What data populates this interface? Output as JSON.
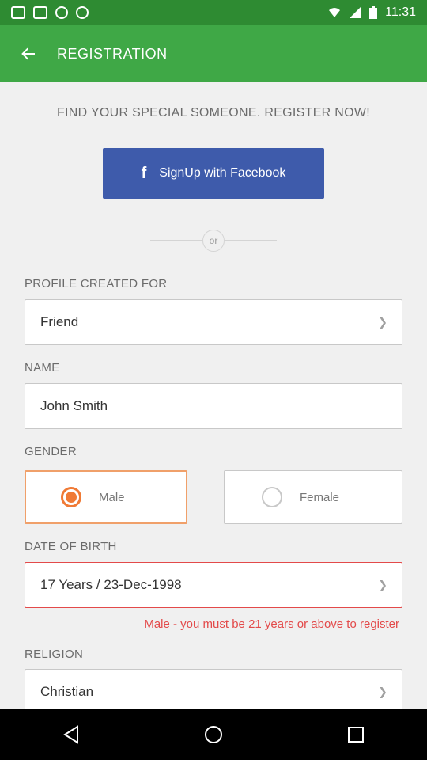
{
  "status_bar": {
    "time": "11:31"
  },
  "app_bar": {
    "title": "REGISTRATION"
  },
  "tagline": "FIND YOUR SPECIAL SOMEONE. REGISTER NOW!",
  "facebook_button": {
    "icon": "f",
    "label": "SignUp with Facebook"
  },
  "divider_text": "or",
  "profile_for": {
    "label": "PROFILE CREATED FOR",
    "value": "Friend"
  },
  "name": {
    "label": "NAME",
    "value": "John Smith"
  },
  "gender": {
    "label": "GENDER",
    "options": [
      "Male",
      "Female"
    ],
    "selected": "Male"
  },
  "dob": {
    "label": "DATE OF BIRTH",
    "value": "17 Years / 23-Dec-1998",
    "error": "Male - you must be 21 years or above to register"
  },
  "religion": {
    "label": "RELIGION",
    "value": "Christian"
  },
  "colors": {
    "primary": "#3fa846",
    "status_bar": "#2e8b32",
    "facebook": "#3e5bab",
    "accent": "#f07a35",
    "error": "#e34a4a"
  }
}
